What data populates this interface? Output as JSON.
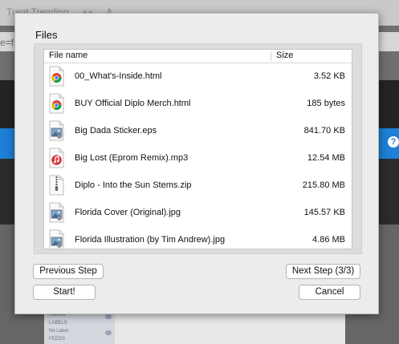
{
  "background": {
    "tab_text": "Trent Trending ... ++ ... A",
    "url_text": "e=fr",
    "help_icon_label": "?",
    "sidebar_labels": [
      "Inactive",
      "LABELS",
      "No Label",
      "FEEDS"
    ]
  },
  "dialog": {
    "title": "Files",
    "columns": {
      "name": "File name",
      "size": "Size"
    },
    "files": [
      {
        "name": "00_What's-Inside.html",
        "size": "3.52 KB",
        "icon": "chrome-html-icon"
      },
      {
        "name": "BUY Official Diplo Merch.html",
        "size": "185 bytes",
        "icon": "chrome-html-icon"
      },
      {
        "name": "Big Dada Sticker.eps",
        "size": "841.70 KB",
        "icon": "image-file-icon"
      },
      {
        "name": "Big Lost (Eprom Remix).mp3",
        "size": "12.54 MB",
        "icon": "music-file-icon"
      },
      {
        "name": "Diplo - Into the Sun Stems.zip",
        "size": "215.80 MB",
        "icon": "zip-file-icon"
      },
      {
        "name": "Florida Cover (Original).jpg",
        "size": "145.57 KB",
        "icon": "image-file-icon"
      },
      {
        "name": "Florida Illustration (by Tim Andrew).jpg",
        "size": "4.86 MB",
        "icon": "image-file-icon"
      }
    ],
    "buttons": {
      "previous": "Previous Step",
      "next": "Next Step (3/3)",
      "start": "Start!",
      "cancel": "Cancel"
    }
  },
  "colors": {
    "accent_blue": "#1d7fd6",
    "dialog_bg": "#ececec",
    "music_red": "#d8383f"
  }
}
